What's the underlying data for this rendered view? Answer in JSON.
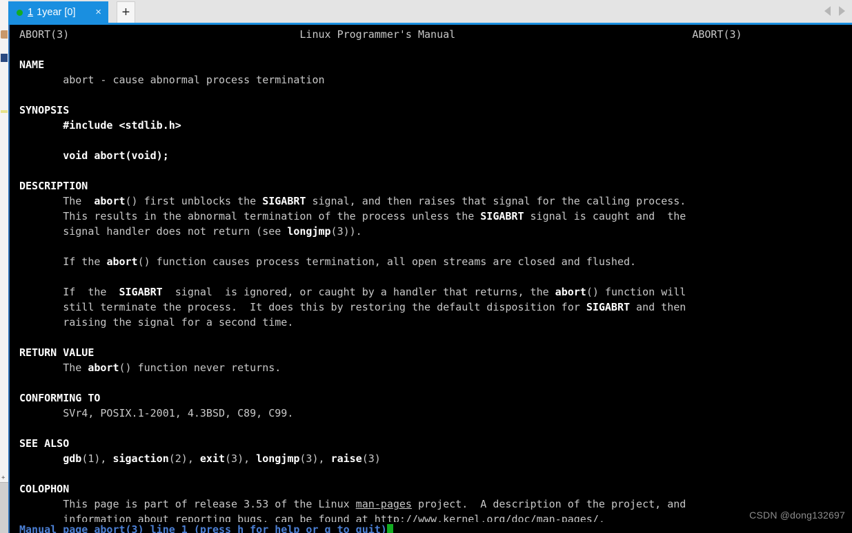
{
  "window": {
    "tab": {
      "dot_color": "#13ac22",
      "index": "1",
      "title": "1year [0]",
      "close_label": "×",
      "active_color": "#1a8fe0"
    },
    "new_tab_label": "+",
    "nav_prev": "◀",
    "nav_next": "▶"
  },
  "terminal": {
    "background": "#000000",
    "foreground": "#c8c8c8",
    "bold_foreground": "#ffffff",
    "header": {
      "left": "ABORT(3)",
      "center": "Linux Programmer's Manual",
      "right": "ABORT(3)"
    },
    "sections": {
      "name": {
        "heading": "NAME",
        "body": "abort - cause abnormal process termination"
      },
      "synopsis": {
        "heading": "SYNOPSIS",
        "include": "#include <stdlib.h>",
        "prototype": "void abort(void);"
      },
      "description": {
        "heading": "DESCRIPTION",
        "p1_l1_a": "The  ",
        "p1_l1_b": "abort",
        "p1_l1_c": "() first unblocks the ",
        "p1_l1_d": "SIGABRT",
        "p1_l1_e": " signal, and then raises that signal for the calling process.",
        "p1_l2_a": "This results in the abnormal termination of the process unless the ",
        "p1_l2_b": "SIGABRT",
        "p1_l2_c": " signal is caught and  the",
        "p1_l3_a": "signal handler does not return (see ",
        "p1_l3_b": "longjmp",
        "p1_l3_c": "(3)).",
        "p2_l1_a": "If the ",
        "p2_l1_b": "abort",
        "p2_l1_c": "() function causes process termination, all open streams are closed and flushed.",
        "p3_l1_a": "If  the  ",
        "p3_l1_b": "SIGABRT",
        "p3_l1_c": "  signal  is ignored, or caught by a handler that returns, the ",
        "p3_l1_d": "abort",
        "p3_l1_e": "() function will",
        "p3_l2_a": "still terminate the process.  It does this by restoring the default disposition for ",
        "p3_l2_b": "SIGABRT",
        "p3_l2_c": " and then",
        "p3_l3": "raising the signal for a second time."
      },
      "return_value": {
        "heading": "RETURN VALUE",
        "body_a": "The ",
        "body_b": "abort",
        "body_c": "() function never returns."
      },
      "conforming_to": {
        "heading": "CONFORMING TO",
        "body": "SVr4, POSIX.1-2001, 4.3BSD, C89, C99."
      },
      "see_also": {
        "heading": "SEE ALSO",
        "i1": "gdb",
        "i1s": "(1), ",
        "i2": "sigaction",
        "i2s": "(2), ",
        "i3": "exit",
        "i3s": "(3), ",
        "i4": "longjmp",
        "i4s": "(3), ",
        "i5": "raise",
        "i5s": "(3)"
      },
      "colophon": {
        "heading": "COLOPHON",
        "l1_a": "This page is part of release 3.53 of the Linux ",
        "l1_b": "man-pages",
        "l1_c": " project.  A description of the project, and",
        "l2_a": "information about reporting bugs, can be found at ",
        "l2_b": "http://www.kernel.org/doc/man-pages/."
      }
    },
    "statusline": "Manual page abort(3) line 1 (press h for help or q to quit)"
  },
  "watermark": "CSDN @dong132697"
}
